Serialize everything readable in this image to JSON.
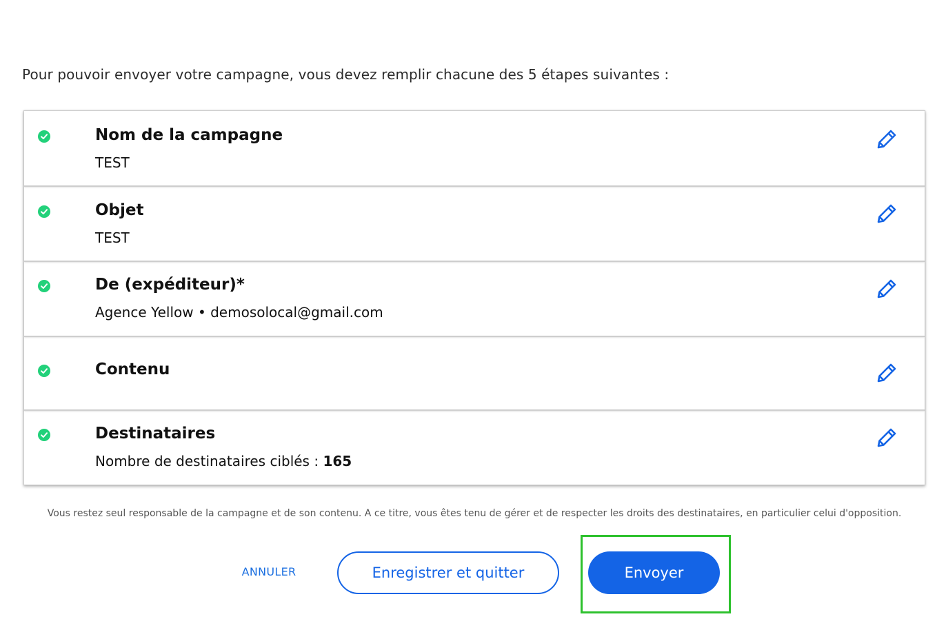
{
  "intro": "Pour pouvoir envoyer votre campagne, vous devez remplir chacune des 5 étapes suivantes :",
  "steps": [
    {
      "title": "Nom de la campagne",
      "value": "TEST",
      "status_icon": "check-circle-icon",
      "edit_icon": "pencil-icon"
    },
    {
      "title": "Objet",
      "value": "TEST",
      "status_icon": "check-circle-icon",
      "edit_icon": "pencil-icon"
    },
    {
      "title": "De (expéditeur)*",
      "value": "Agence Yellow • demosolocal@gmail.com",
      "status_icon": "check-circle-icon",
      "edit_icon": "pencil-icon"
    },
    {
      "title": "Contenu",
      "value": "",
      "status_icon": "check-circle-icon",
      "edit_icon": "pencil-icon"
    },
    {
      "title": "Destinataires",
      "value_label": "Nombre de destinataires ciblés : ",
      "value_count": "165",
      "status_icon": "check-circle-icon",
      "edit_icon": "pencil-icon"
    }
  ],
  "disclaimer": "Vous restez seul responsable de la campagne et de son contenu. A ce titre, vous êtes tenu de gérer et de respecter les droits des destinataires, en particulier celui d'opposition.",
  "actions": {
    "cancel_label": "ANNULER",
    "save_label": "Enregistrer et quitter",
    "send_label": "Envoyer"
  },
  "colors": {
    "primary": "#1464e6",
    "check": "#22d17a",
    "highlight": "#2dc12d"
  }
}
